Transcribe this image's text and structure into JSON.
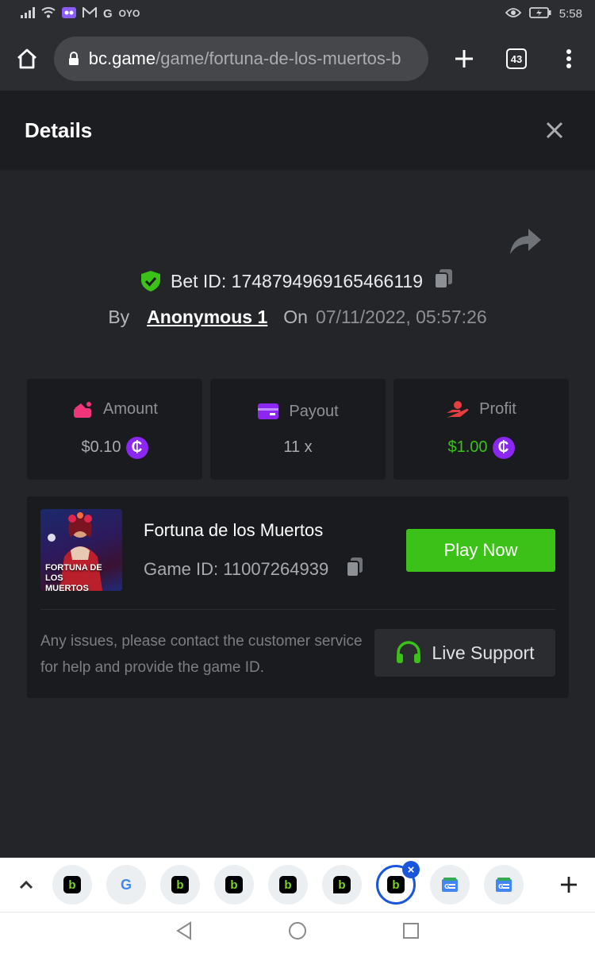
{
  "status_bar": {
    "time": "5:58",
    "mini_label": "OYO"
  },
  "browser": {
    "url_host": "bc.game",
    "url_path": "/game/fortuna-de-los-muertos-b",
    "tabs_count": "43"
  },
  "details": {
    "title": "Details",
    "bet_id": "Bet ID: 1748794969165466119",
    "by_label": "By",
    "user": "Anonymous 1",
    "on_label": "On",
    "date": "07/11/2022, 05:57:26"
  },
  "stats": [
    {
      "label": "Amount",
      "value": "$0.10",
      "icon": "money-bag-icon",
      "accent": "#f0357a"
    },
    {
      "label": "Payout",
      "value": "11 x",
      "icon": "card-icon",
      "accent": "#8b27f0"
    },
    {
      "label": "Profit",
      "value": "$1.00",
      "icon": "hand-profit-icon",
      "accent": "#e63e3e"
    }
  ],
  "coin_symbol": "₵",
  "game": {
    "thumb_title": "FORTUNA DE LOS MUERTOS",
    "name": "Fortuna de los Muertos",
    "game_id": "Game ID: 11007264939",
    "play_label": "Play Now",
    "help_text": "Any issues, please contact the customer service for help and provide the game ID.",
    "support_label": "Live Support"
  },
  "colors": {
    "accent_green": "#3bc117",
    "coin_purple": "#8b27f0",
    "active_tab_blue": "#1a56db"
  },
  "tab_strip": {
    "tabs": [
      "bc-game",
      "google",
      "bc-game",
      "bc-game",
      "bc-game",
      "bc-game-chat",
      "bc-game",
      "google-news",
      "google-news"
    ],
    "active_index": 6
  }
}
